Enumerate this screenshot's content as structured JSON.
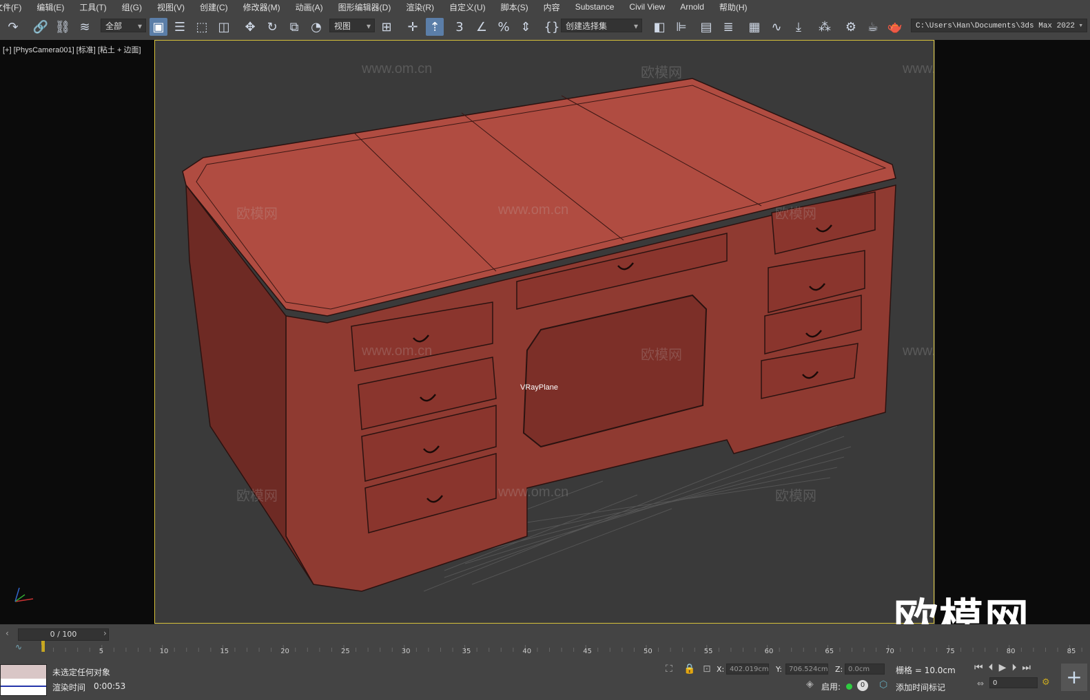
{
  "menu": [
    "文件(F)",
    "编辑(E)",
    "工具(T)",
    "组(G)",
    "视图(V)",
    "创建(C)",
    "修改器(M)",
    "动画(A)",
    "图形编辑器(D)",
    "渲染(R)",
    "自定义(U)",
    "脚本(S)",
    "内容",
    "Substance",
    "Civil View",
    "Arnold",
    "帮助(H)"
  ],
  "toolbar": {
    "filter_value": "全部",
    "coord_value": "视图",
    "selection_set_value": "创建选择集",
    "path_value": "C:\\Users\\Han\\Documents\\3ds Max 2022"
  },
  "viewport": {
    "label": "[+] [PhysCamera001] [标准] [粘土 + 边面]",
    "object_label": "VRayPlane",
    "watermark_small": "欧模网",
    "watermark_url": "www.om.cn",
    "watermark_big": "欧模网"
  },
  "timeline": {
    "frame_display": "0 / 100",
    "ticks": [
      "5",
      "10",
      "15",
      "20",
      "25",
      "30",
      "35",
      "40",
      "45",
      "50",
      "55",
      "60",
      "65",
      "70",
      "75",
      "80",
      "85"
    ]
  },
  "status": {
    "selection_msg": "未选定任何对象",
    "render_label": "渲染时间",
    "render_time": "0:00:53",
    "x_label": "X:",
    "x_value": "402.019cm",
    "y_label": "Y:",
    "y_value": "706.524cm",
    "z_label": "Z:",
    "z_value": "0.0cm",
    "grid": "栅格 = 10.0cm",
    "enable_label": "启用:",
    "add_time_tag": "添加时间标记",
    "frame_value": "0"
  },
  "colors": {
    "viewport_border": "#d8c23a",
    "clay_red": "#a9473d",
    "active_button": "#5b7ea8"
  }
}
